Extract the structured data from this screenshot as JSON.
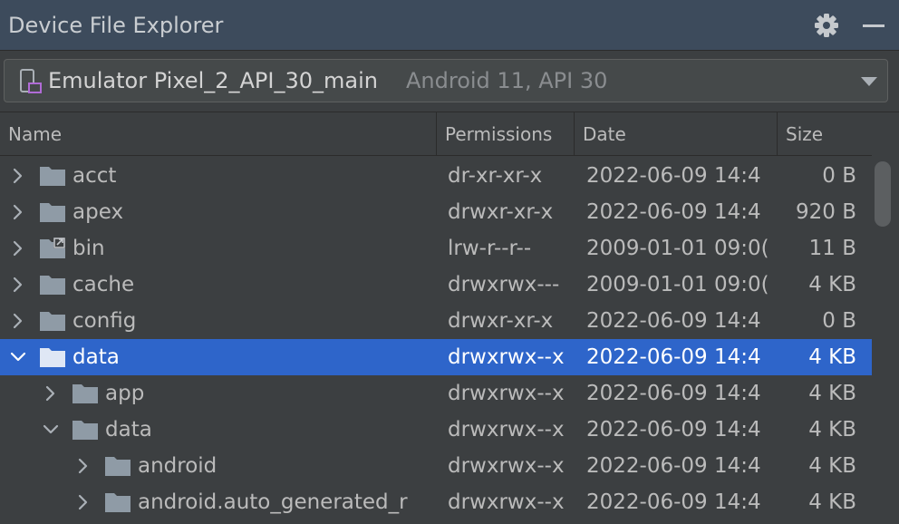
{
  "window": {
    "title": "Device File Explorer"
  },
  "device": {
    "name": "Emulator Pixel_2_API_30_main",
    "detail": "Android 11, API 30"
  },
  "columns": {
    "name": "Name",
    "permissions": "Permissions",
    "date": "Date",
    "size": "Size"
  },
  "files": [
    {
      "name": "acct",
      "permissions": "dr-xr-xr-x",
      "date": "2022-06-09 14:4",
      "size": "0 B",
      "depth": 0,
      "expanded": false,
      "symlink": false,
      "selected": false
    },
    {
      "name": "apex",
      "permissions": "drwxr-xr-x",
      "date": "2022-06-09 14:4",
      "size": "920 B",
      "depth": 0,
      "expanded": false,
      "symlink": false,
      "selected": false
    },
    {
      "name": "bin",
      "permissions": "lrw-r--r--",
      "date": "2009-01-01 09:0(",
      "size": "11 B",
      "depth": 0,
      "expanded": false,
      "symlink": true,
      "selected": false
    },
    {
      "name": "cache",
      "permissions": "drwxrwx---",
      "date": "2009-01-01 09:0(",
      "size": "4 KB",
      "depth": 0,
      "expanded": false,
      "symlink": false,
      "selected": false
    },
    {
      "name": "config",
      "permissions": "drwxr-xr-x",
      "date": "2022-06-09 14:4",
      "size": "0 B",
      "depth": 0,
      "expanded": false,
      "symlink": false,
      "selected": false
    },
    {
      "name": "data",
      "permissions": "drwxrwx--x",
      "date": "2022-06-09 14:4",
      "size": "4 KB",
      "depth": 0,
      "expanded": true,
      "symlink": false,
      "selected": true
    },
    {
      "name": "app",
      "permissions": "drwxrwx--x",
      "date": "2022-06-09 14:4",
      "size": "4 KB",
      "depth": 1,
      "expanded": false,
      "symlink": false,
      "selected": false
    },
    {
      "name": "data",
      "permissions": "drwxrwx--x",
      "date": "2022-06-09 14:4",
      "size": "4 KB",
      "depth": 1,
      "expanded": true,
      "symlink": false,
      "selected": false
    },
    {
      "name": "android",
      "permissions": "drwxrwx--x",
      "date": "2022-06-09 14:4",
      "size": "4 KB",
      "depth": 2,
      "expanded": false,
      "symlink": false,
      "selected": false
    },
    {
      "name": "android.auto_generated_r",
      "permissions": "drwxrwx--x",
      "date": "2022-06-09 14:4",
      "size": "4 KB",
      "depth": 2,
      "expanded": false,
      "symlink": false,
      "selected": false
    }
  ],
  "colors": {
    "selection": "#2e65ca",
    "folder": "#8f9ba6",
    "title_bar": "#3d4b5c"
  },
  "icons": {
    "settings": "gear-icon",
    "minimize": "minimize-icon",
    "device": "phone-icon",
    "dropdown": "chevron-down-icon",
    "folder": "folder-icon",
    "symlink": "folder-link-icon"
  }
}
